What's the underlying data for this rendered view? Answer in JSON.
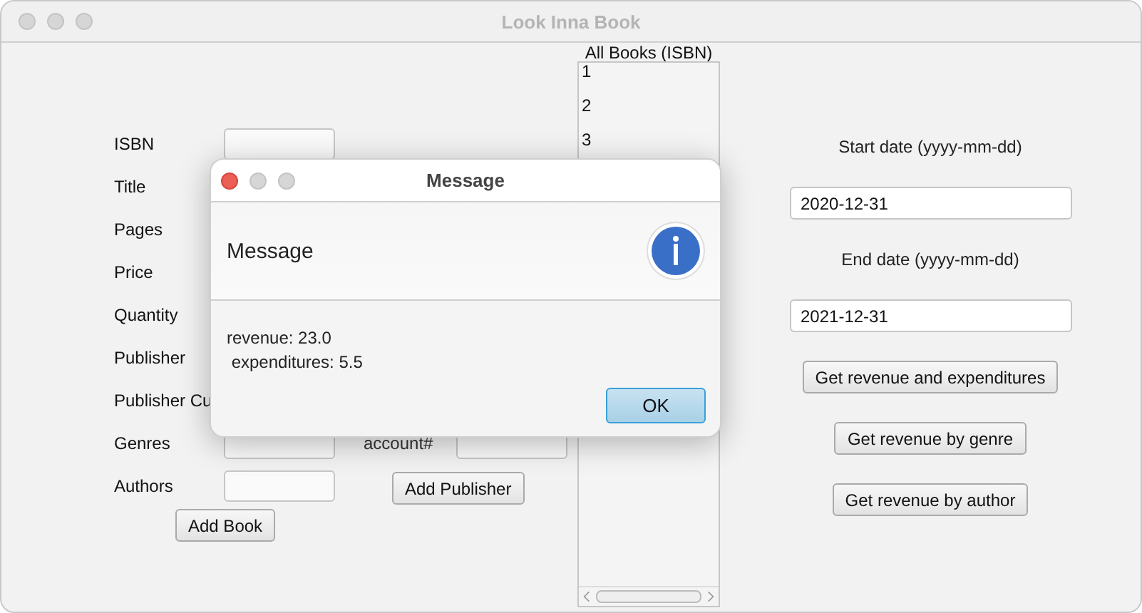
{
  "window": {
    "title": "Look Inna Book"
  },
  "book_form": {
    "rows": [
      {
        "label": "ISBN",
        "field": true
      },
      {
        "label": "Title",
        "field": false
      },
      {
        "label": "Pages",
        "field": false
      },
      {
        "label": "Price",
        "field": false
      },
      {
        "label": "Quantity",
        "field": false
      },
      {
        "label": "Publisher",
        "field": false
      },
      {
        "label": "Publisher Cu",
        "field": false
      },
      {
        "label": "Genres",
        "field": true
      },
      {
        "label": "Authors",
        "field": true
      }
    ],
    "button": "Add Book"
  },
  "publisher_form": {
    "label": "account#",
    "button": "Add Publisher"
  },
  "book_list": {
    "header": "All Books (ISBN)",
    "items": [
      "1",
      "2",
      "3"
    ]
  },
  "report": {
    "start_label": "Start date (yyyy-mm-dd)",
    "start_value": "2020-12-31",
    "end_label": "End date (yyyy-mm-dd)",
    "end_value": "2021-12-31",
    "buttons": [
      "Get revenue and expenditures",
      "Get revenue by genre",
      "Get revenue by author"
    ]
  },
  "dialog": {
    "title": "Message",
    "header": "Message",
    "message": "revenue: 23.0\n expenditures: 5.5",
    "button": "OK"
  }
}
